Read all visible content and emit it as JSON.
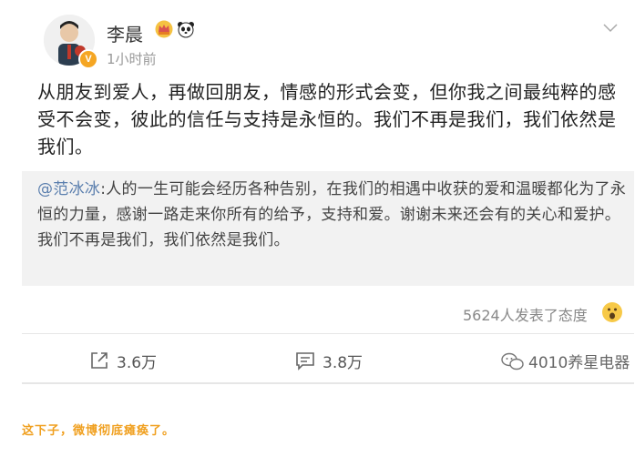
{
  "post": {
    "username": "李晨",
    "time": "1小时前",
    "text": "从朋友到爱人，再做回朋友，情感的形式会变，但你我之间最纯粹的感受不会变，彼此的信任与支持是永恒的。我们不再是我们，我们依然是我们。",
    "avatar_badge": "V"
  },
  "repost": {
    "mention": "@范冰冰",
    "text": ":人的一生可能会经历各种告别，在我们的相遇中收获的爱和温暖都化为了永恒的力量，感谢一路走来你所有的给予，支持和爱。谢谢未来还会有的关心和爱护。",
    "text2": "我们不再是我们，我们依然是我们。"
  },
  "reactions": {
    "summary": "5624人发表了态度"
  },
  "actions": {
    "repost_count": "3.6万",
    "comment_count": "3.8万"
  },
  "watermark": "4010养星电器",
  "caption": "这下子，微博彻底瘫痪了。",
  "colors": {
    "mention": "#5b7fae",
    "caption": "#f0a020",
    "badge": "#f5a623"
  }
}
